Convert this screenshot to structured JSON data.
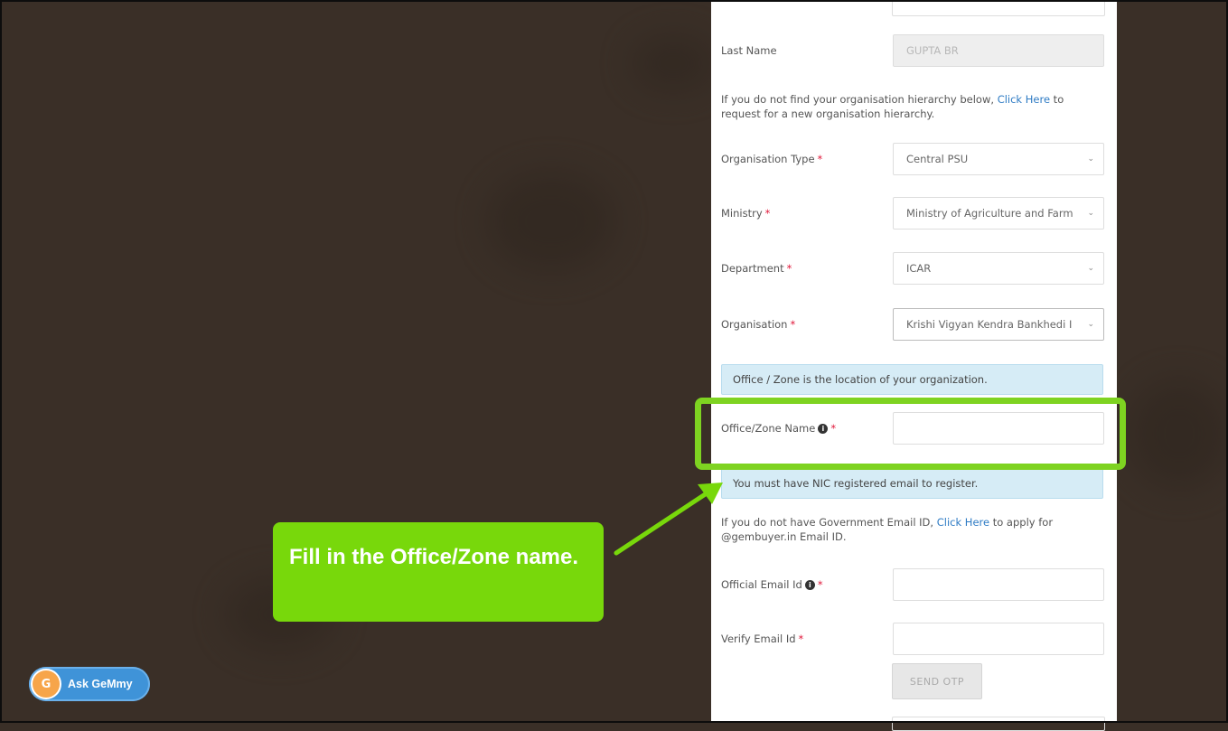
{
  "form": {
    "last_name": {
      "label": "Last Name",
      "value": "GUPTA BR"
    },
    "hierarchy_note": {
      "before": "If you do not find your organisation hierarchy below, ",
      "link": "Click Here",
      "after": " to request for a new organisation hierarchy."
    },
    "org_type": {
      "label": "Organisation Type",
      "required": "*",
      "value": "Central PSU"
    },
    "ministry": {
      "label": "Ministry",
      "required": "*",
      "value": "Ministry of Agriculture and Farm"
    },
    "department": {
      "label": "Department",
      "required": "*",
      "value": "ICAR"
    },
    "organisation": {
      "label": "Organisation",
      "required": "*",
      "value": "Krishi Vigyan Kendra Bankhedi I"
    },
    "office_alert": "Office / Zone is the location of your organization.",
    "office_zone": {
      "label": "Office/Zone Name",
      "info": "i",
      "required": "*",
      "value": ""
    },
    "nic_alert": "You must have NIC registered email to register.",
    "gov_email_note": {
      "before": "If you do not have Government Email ID, ",
      "link": "Click Here",
      "after": " to apply for @gembuyer.in Email ID."
    },
    "official_email": {
      "label": "Official Email Id",
      "info": "i",
      "required": "*",
      "value": ""
    },
    "verify_email": {
      "label": "Verify Email Id",
      "required": "*",
      "value": ""
    },
    "send_otp": "SEND OTP"
  },
  "callout": {
    "text": "Fill in the Office/Zone name."
  },
  "assistant": {
    "label": "Ask GeMmy",
    "avatar": "G"
  },
  "colors": {
    "highlight": "#7ed321",
    "callout_bg": "#78d80b",
    "link": "#2e7bc4",
    "alert_bg": "#d6ecf6",
    "backdrop": "#3a2f27"
  }
}
